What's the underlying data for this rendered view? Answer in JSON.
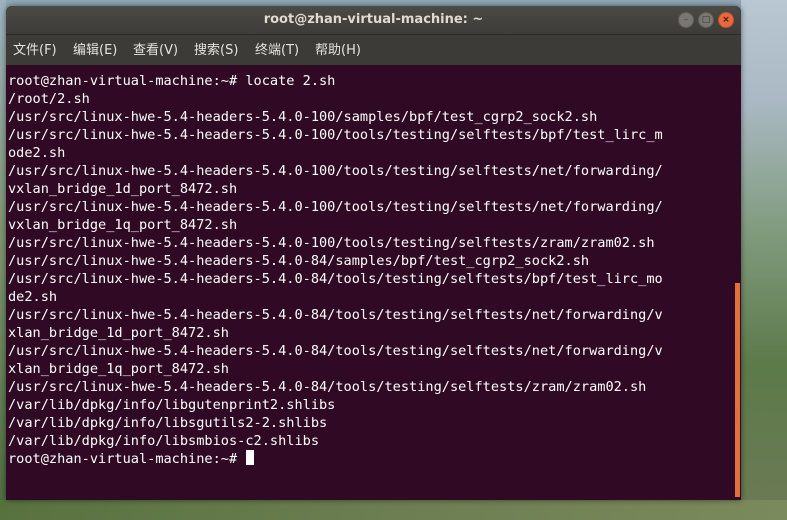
{
  "window": {
    "title": "root@zhan-virtual-machine: ~",
    "controls": {
      "minimize": "–",
      "maximize": "□",
      "close": "×"
    }
  },
  "menu": [
    "文件(F)",
    "编辑(E)",
    "查看(V)",
    "搜索(S)",
    "终端(T)",
    "帮助(H)"
  ],
  "terminal": {
    "lines": [
      "root@zhan-virtual-machine:~# locate 2.sh",
      "/root/2.sh",
      "/usr/src/linux-hwe-5.4-headers-5.4.0-100/samples/bpf/test_cgrp2_sock2.sh",
      "/usr/src/linux-hwe-5.4-headers-5.4.0-100/tools/testing/selftests/bpf/test_lirc_m",
      "ode2.sh",
      "/usr/src/linux-hwe-5.4-headers-5.4.0-100/tools/testing/selftests/net/forwarding/",
      "vxlan_bridge_1d_port_8472.sh",
      "/usr/src/linux-hwe-5.4-headers-5.4.0-100/tools/testing/selftests/net/forwarding/",
      "vxlan_bridge_1q_port_8472.sh",
      "/usr/src/linux-hwe-5.4-headers-5.4.0-100/tools/testing/selftests/zram/zram02.sh",
      "/usr/src/linux-hwe-5.4-headers-5.4.0-84/samples/bpf/test_cgrp2_sock2.sh",
      "/usr/src/linux-hwe-5.4-headers-5.4.0-84/tools/testing/selftests/bpf/test_lirc_mo",
      "de2.sh",
      "/usr/src/linux-hwe-5.4-headers-5.4.0-84/tools/testing/selftests/net/forwarding/v",
      "xlan_bridge_1d_port_8472.sh",
      "/usr/src/linux-hwe-5.4-headers-5.4.0-84/tools/testing/selftests/net/forwarding/v",
      "xlan_bridge_1q_port_8472.sh",
      "/usr/src/linux-hwe-5.4-headers-5.4.0-84/tools/testing/selftests/zram/zram02.sh",
      "/var/lib/dpkg/info/libgutenprint2.shlibs",
      "/var/lib/dpkg/info/libsgutils2-2.shlibs",
      "/var/lib/dpkg/info/libsmbios-c2.shlibs"
    ],
    "prompt": "root@zhan-virtual-machine:~# "
  },
  "colors": {
    "terminal_bg": "#300a24",
    "titlebar_bg": "#3e3c38",
    "menubar_bg": "#3c3b37",
    "close_button": "#e9683f",
    "scrollbar": "#e2703a",
    "text": "#ffffff"
  }
}
